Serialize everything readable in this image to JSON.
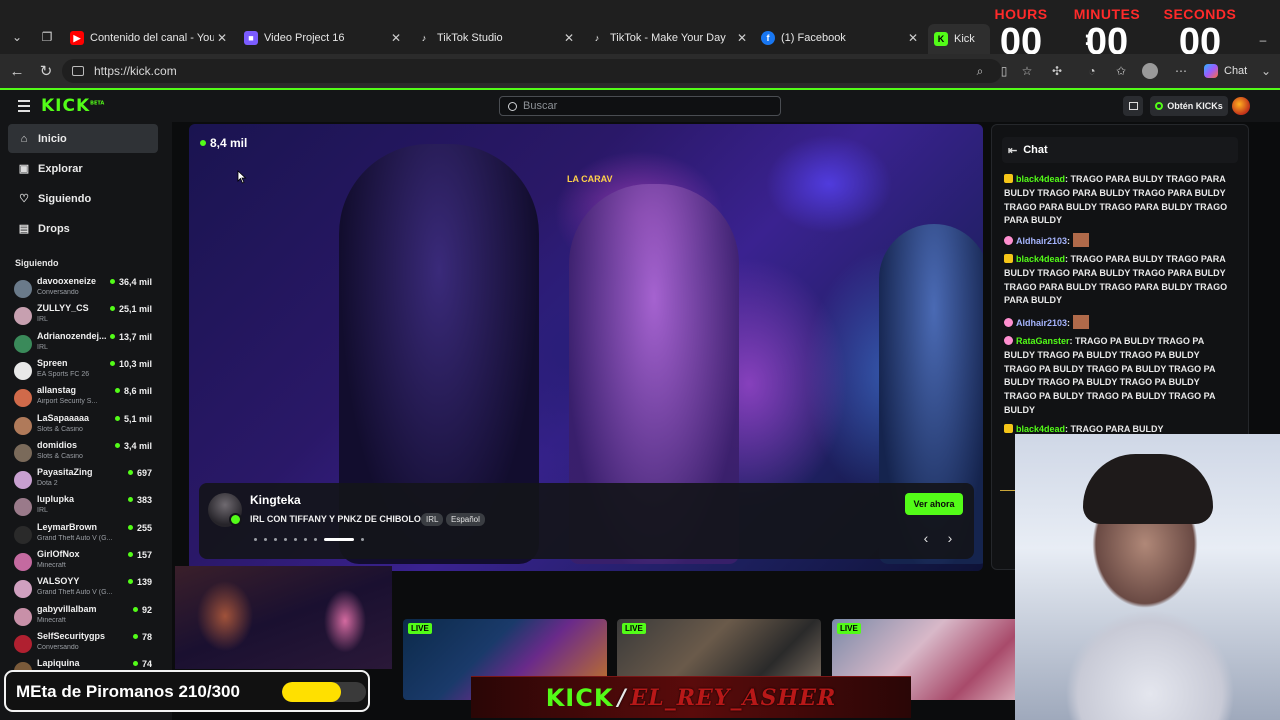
{
  "browser": {
    "tabs": [
      {
        "title": "Contenido del canal - YouTube",
        "favicon": "youtube-icon"
      },
      {
        "title": "Video Project 16",
        "favicon": "clipchamp-icon"
      },
      {
        "title": "TikTok Studio",
        "favicon": "tiktok-icon"
      },
      {
        "title": "TikTok - Make Your Day",
        "favicon": "tiktok-icon"
      },
      {
        "title": "(1) Facebook",
        "favicon": "facebook-icon"
      },
      {
        "title": "Kick",
        "favicon": "kick-icon"
      }
    ],
    "url": "https://kick.com",
    "chat_button": "Chat"
  },
  "timer": {
    "hours_label": "HOURS",
    "hours": "00",
    "minutes_label": "MINUTES",
    "minutes": "00",
    "seconds_label": "SECONDS",
    "seconds": "00",
    "separator": ":"
  },
  "header": {
    "logo": "KICK",
    "logo_badge": "BETA",
    "search_placeholder": "Buscar",
    "kicks_button": "Obtén KICKs"
  },
  "sidebar": {
    "nav": [
      {
        "label": "Inicio",
        "icon": "home-icon",
        "active": true
      },
      {
        "label": "Explorar",
        "icon": "compass-icon",
        "active": false
      },
      {
        "label": "Siguiendo",
        "icon": "heart-icon",
        "active": false
      },
      {
        "label": "Drops",
        "icon": "drops-icon",
        "active": false
      }
    ],
    "following_title": "Siguiendo",
    "channels": [
      {
        "name": "davooxeneize",
        "category": "Conversando",
        "viewers": "36,4 mil"
      },
      {
        "name": "ZULLYY_CS",
        "category": "IRL",
        "viewers": "25,1 mil"
      },
      {
        "name": "Adrianozendej...",
        "category": "IRL",
        "viewers": "13,7 mil"
      },
      {
        "name": "Spreen",
        "category": "EA Sports FC 26",
        "viewers": "10,3 mil"
      },
      {
        "name": "allanstag",
        "category": "Airport Security S...",
        "viewers": "8,6 mil"
      },
      {
        "name": "LaSapaaaaa",
        "category": "Slots & Casino",
        "viewers": "5,1 mil"
      },
      {
        "name": "domidios",
        "category": "Slots & Casino",
        "viewers": "3,4 mil"
      },
      {
        "name": "PayasitaZing",
        "category": "Dota 2",
        "viewers": "697"
      },
      {
        "name": "luplupka",
        "category": "IRL",
        "viewers": "383"
      },
      {
        "name": "LeymarBrown",
        "category": "Grand Theft Auto V (G...",
        "viewers": "255"
      },
      {
        "name": "GirlOfNox",
        "category": "Minecraft",
        "viewers": "157"
      },
      {
        "name": "VALSOYY",
        "category": "Grand Theft Auto V (G...",
        "viewers": "139"
      },
      {
        "name": "gabyvillalbam",
        "category": "Minecraft",
        "viewers": "92"
      },
      {
        "name": "SelfSecuritygps",
        "category": "Conversando",
        "viewers": "78"
      },
      {
        "name": "Lapiquina",
        "category": "",
        "viewers": "74"
      }
    ]
  },
  "featured": {
    "viewers": "8,4 mil",
    "video_sign": "LA CARAV",
    "streamer": "Kingteka",
    "title": "IRL CON TIFFANY Y PNKZ DE CHIBOLO",
    "tags": [
      "IRL",
      "Español"
    ],
    "watch_button": "Ver ahora",
    "prev_icon": "‹",
    "next_icon": "›"
  },
  "thumbnails": [
    {
      "live": "LIVE"
    },
    {
      "live": "LIVE"
    },
    {
      "live": "LIVE"
    }
  ],
  "chat": {
    "title": "Chat",
    "messages": [
      {
        "user": "black4dead",
        "text": "TRAGO PARA BULDY TRAGO PARA BULDY TRAGO PARA BULDY TRAGO PARA BULDY TRAGO PARA BULDY TRAGO PARA BULDY TRAGO PARA BULDY"
      },
      {
        "user": "Aldhair2103",
        "text": ""
      },
      {
        "user": "black4dead",
        "text": "TRAGO PARA BULDY TRAGO PARA BULDY TRAGO PARA BULDY TRAGO PARA BULDY TRAGO PARA BULDY TRAGO PARA BULDY TRAGO PARA BULDY"
      },
      {
        "user": "Aldhair2103",
        "text": ""
      },
      {
        "user": "RataGanster",
        "text": "TRAGO PA BULDY TRAGO PA BULDY TRAGO PA BULDY TRAGO PA BULDY TRAGO PA BULDY TRAGO PA BULDY TRAGO PA BULDY TRAGO PA BULDY TRAGO PA BULDY TRAGO PA BULDY TRAGO PA BULDY TRAGO PA BULDY"
      },
      {
        "user": "black4dead",
        "text": "TRAGO PARA BULDY"
      }
    ]
  },
  "overlay": {
    "meta_text": "MEta de Piromanos 210/300",
    "meta_progress": 0.7,
    "banner_kick": "KICK",
    "banner_slash": "/",
    "banner_name": "EL_REY_ASHER"
  }
}
